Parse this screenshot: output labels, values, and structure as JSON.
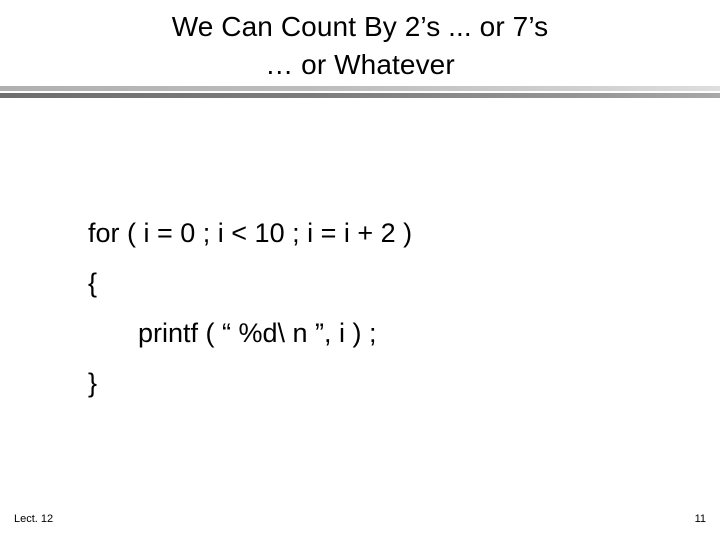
{
  "slide": {
    "title": {
      "line1": "We Can Count By 2’s ... or 7’s",
      "line2": "… or Whatever"
    },
    "divider": {
      "top_bar_color": "#bdbdbd",
      "bottom_bar_color": "#7d7d7d"
    },
    "code": {
      "lines": [
        "for ( i = 0 ; i < 10 ; i = i + 2 )",
        "{",
        "printf ( “ %d\\ n ”, i ) ;",
        "}"
      ]
    },
    "footer": {
      "lecture_label": "Lect. 12",
      "page_number": "11"
    }
  }
}
